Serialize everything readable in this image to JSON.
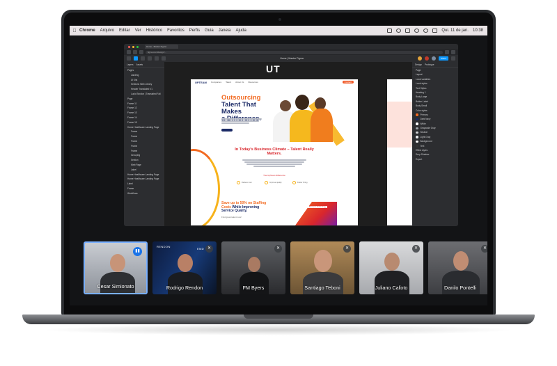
{
  "menubar": {
    "items": [
      "Chrome",
      "Arquivo",
      "Editar",
      "Ver",
      "Histórico",
      "Favoritos",
      "Perfis",
      "Guia",
      "Janela",
      "Ajuda"
    ],
    "date": "Qui. 11 de jan.",
    "time": "10:38"
  },
  "browser": {
    "tab": "Home - Master Figma",
    "url": "figma.com/design/…",
    "file_name": "Home | Master Figma",
    "share_label": "Share",
    "layers_tabs": [
      "Layers",
      "Assets"
    ],
    "layers": [
      "Pages",
      "Landing",
      "Ui Kits",
      "Sections Web Library",
      "Header Translated V1",
      "Lucid Section | Translated Fall",
      "Page",
      "Frame 11",
      "Frame 12",
      "Frame 13",
      "Frame 14",
      "Frame 15",
      "Home Healthcare Landing Page",
      "Frame",
      "Frame",
      "Frame",
      "Frame",
      "Frame",
      "Grouping",
      "Section",
      "Web Page",
      "Label",
      "Home Healthcare Landing Page",
      "Home Healthcare Landing Page",
      "Label",
      "Frame",
      "Workflows"
    ],
    "props_tabs": [
      "Design",
      "Prototype"
    ],
    "props": [
      "Page",
      "Layout",
      "Local variables",
      "Local styles",
      "Text Styles",
      "Heading 1",
      "Body Large",
      "Button Label",
      "Body Small",
      "Color styles",
      "Primary",
      "Dark Navy",
      "White",
      "Grayscale Gray",
      "Neutral",
      "Light Gray",
      "Background",
      "Text",
      "Effect styles",
      "Drop Shadow",
      "Export"
    ],
    "swatch_colors": [
      "#f26a21",
      "#1b2a66",
      "#ffffff",
      "#9aa0a6",
      "#cfd0d2",
      "#e8eaed",
      "#f7f7f7",
      "#333333"
    ]
  },
  "design": {
    "watermark": "UT",
    "logo": "UPTEAM",
    "nav": [
      "Companies",
      "Talent",
      "About Us",
      "Resources"
    ],
    "nav_cta": "Contact",
    "hero_title_1": "Outsourcing",
    "hero_title_2": "Talent That Makes",
    "hero_title_3": "a Difference.",
    "section_title": "In Today's Business Climate – Talent Really Matters.",
    "section_small": "The UpTeam Difference",
    "chips": [
      "Reduce cost",
      "Improve quality",
      "Faster hiring"
    ],
    "save_1": "Save up to 50% on Staffing",
    "save_2": "Costs ",
    "save_3": "While Improving",
    "save_4": "Service Quality.",
    "save_sub": "Find great talent now!",
    "grad_label": "Business Technology"
  },
  "participants": [
    {
      "name": "Cesar Simionato",
      "status": "speaking"
    },
    {
      "name": "Rodrigo Rendon",
      "status": "muted",
      "brand": "RENDON",
      "brand2": "EMD"
    },
    {
      "name": "FM Byers",
      "status": "muted"
    },
    {
      "name": "Santiago Teboni",
      "status": "muted"
    },
    {
      "name": "Juliano Calixto",
      "status": "muted"
    },
    {
      "name": "Danilo Pontelli",
      "status": "muted"
    }
  ],
  "colors": {
    "accent": "#1a73e8",
    "brand_orange": "#f26a21",
    "brand_navy": "#1b2a66",
    "figma_blue": "#0d99ff"
  }
}
